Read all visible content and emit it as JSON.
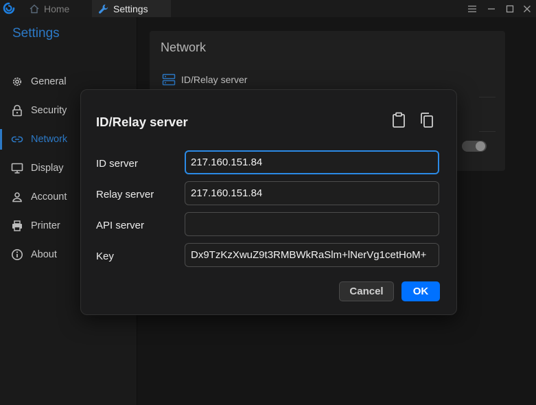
{
  "titlebar": {
    "tabs": [
      {
        "label": "Home",
        "icon": "home-icon"
      },
      {
        "label": "Settings",
        "icon": "wrench-icon"
      }
    ],
    "controls": [
      "menu-icon",
      "minimize-icon",
      "maximize-icon",
      "close-icon"
    ]
  },
  "sidebar": {
    "title": "Settings",
    "items": [
      {
        "label": "General",
        "icon": "gear-icon"
      },
      {
        "label": "Security",
        "icon": "lock-icon"
      },
      {
        "label": "Network",
        "icon": "link-icon",
        "active": true
      },
      {
        "label": "Display",
        "icon": "monitor-icon"
      },
      {
        "label": "Account",
        "icon": "person-icon"
      },
      {
        "label": "Printer",
        "icon": "printer-icon"
      },
      {
        "label": "About",
        "icon": "info-icon"
      }
    ]
  },
  "main": {
    "section_title": "Network",
    "row_label": "ID/Relay server"
  },
  "dialog": {
    "title": "ID/Relay server",
    "fields": [
      {
        "label": "ID server",
        "value": "217.160.151.84"
      },
      {
        "label": "Relay server",
        "value": "217.160.151.84"
      },
      {
        "label": "API server",
        "value": ""
      },
      {
        "label": "Key",
        "value": "Dx9TzKzXwuZ9t3RMBWkRaSlm+lNerVg1cetHoM+"
      }
    ],
    "cancel_label": "Cancel",
    "ok_label": "OK"
  },
  "colors": {
    "accent": "#2c79c6",
    "ok_button": "#0071ff",
    "focus_border": "#2b8ae6"
  }
}
